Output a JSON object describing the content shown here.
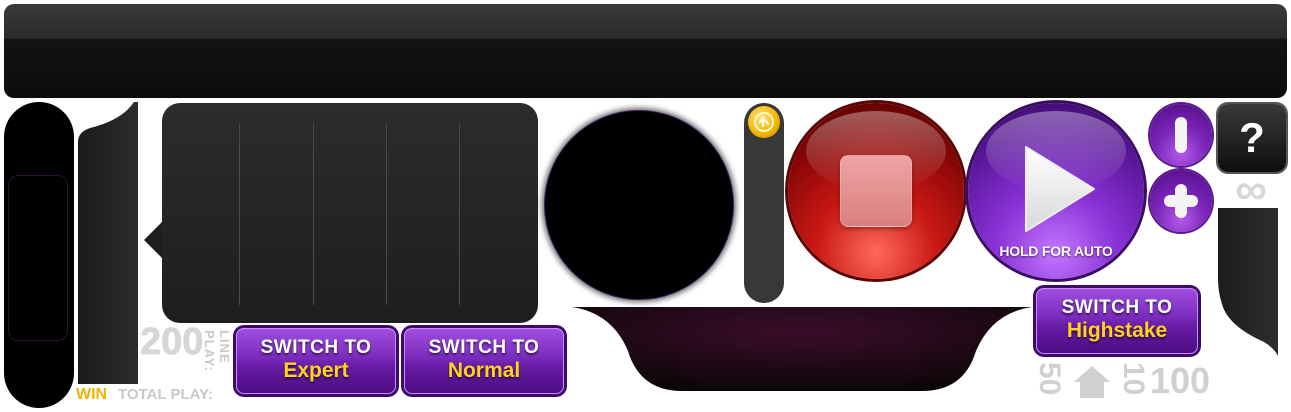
{
  "controls": {
    "hold_for_auto": "HOLD FOR AUTO",
    "help": "?",
    "infinity": "∞"
  },
  "switches": {
    "expert": {
      "top": "SWITCH TO",
      "bottom": "Expert"
    },
    "normal": {
      "top": "SWITCH TO",
      "bottom": "Normal"
    },
    "highstake": {
      "top": "SWITCH TO",
      "bottom": "Highstake"
    }
  },
  "bet": {
    "line_value": "200",
    "line_play_label": "LINE PLAY:",
    "win_label": "WIN",
    "total_play_label": "TOTAL PLAY:"
  },
  "stakes": {
    "low": "50",
    "mid": "10",
    "high": "100"
  },
  "colors": {
    "accent_purple": "#7a24b8",
    "stop_red": "#c81814",
    "win_gold": "#f0b400",
    "coin_gold": "#f2b200"
  },
  "icons": [
    "coin-icon",
    "stop-icon",
    "play-icon",
    "minus-icon",
    "plus-icon",
    "help-icon",
    "home-icon",
    "infinity-icon"
  ]
}
